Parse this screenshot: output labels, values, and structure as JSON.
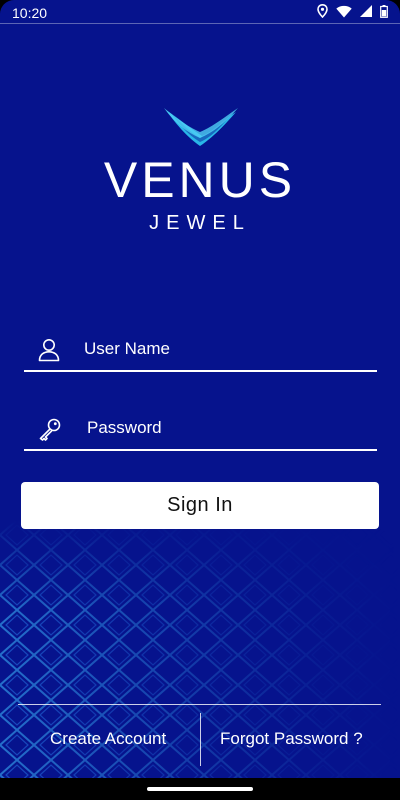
{
  "status_bar": {
    "time": "10:20",
    "icons": [
      "location-icon",
      "wifi-icon",
      "cellular-icon",
      "battery-icon"
    ]
  },
  "brand": {
    "name": "VENUS",
    "subtitle": "JEWEL",
    "mark_icon": "venus-wave-logo"
  },
  "form": {
    "username": {
      "placeholder": "User Name",
      "value": "",
      "icon": "user-icon"
    },
    "password": {
      "placeholder": "Password",
      "value": "",
      "icon": "key-icon"
    },
    "signin_label": "Sign In"
  },
  "footer": {
    "create_account": "Create Account",
    "forgot_password": "Forgot Password ?"
  },
  "colors": {
    "background": "#06138d",
    "accent_wave": "#29b6e8",
    "text": "#ffffff",
    "button": "#ffffff"
  }
}
